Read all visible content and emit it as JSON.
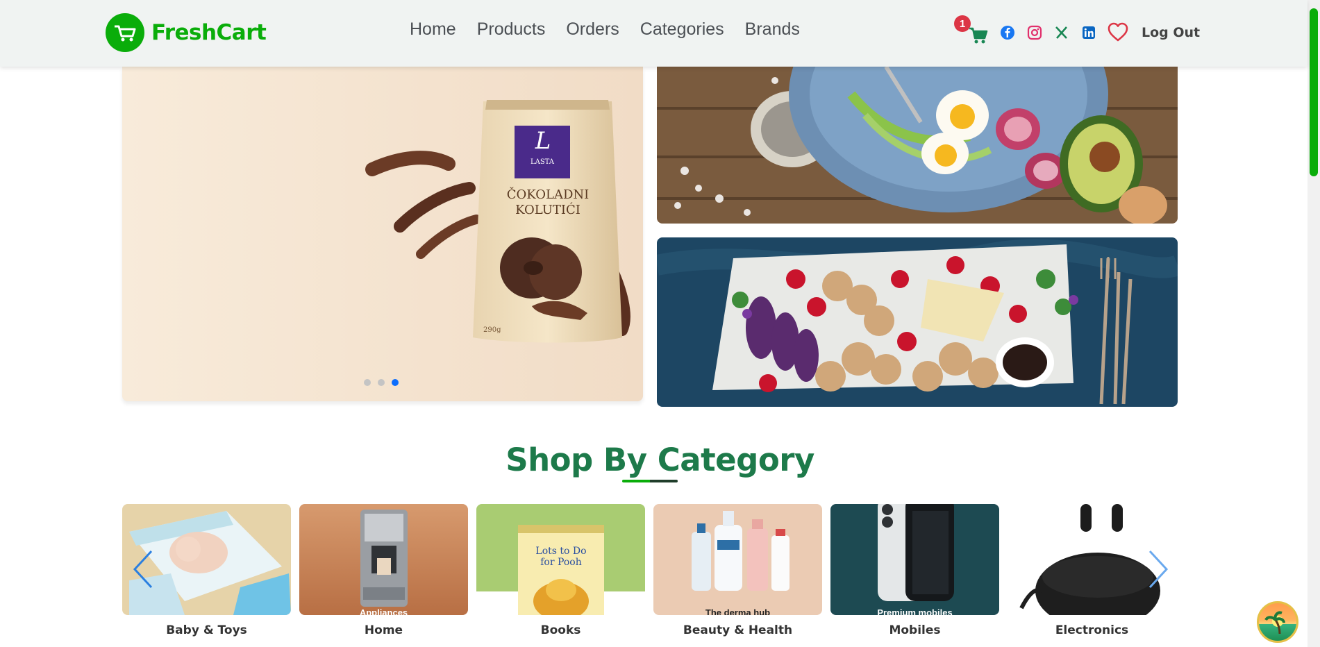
{
  "brand": {
    "name": "FreshCart"
  },
  "nav": {
    "links": [
      "Home",
      "Products",
      "Orders",
      "Categories",
      "Brands"
    ],
    "cart_count": "1",
    "logout_label": "Log Out"
  },
  "hero": {
    "product_brand": "LASTA",
    "product_name_line1": "ČOKOLADNI",
    "product_name_line2": "KOLUTIĆI",
    "product_weight": "290g",
    "slide_count": 3,
    "active_slide": 3
  },
  "section": {
    "title": "Shop By Category"
  },
  "categories": [
    {
      "label": "Baby & Toys",
      "caption": ""
    },
    {
      "label": "Home",
      "caption": "Appliances"
    },
    {
      "label": "Books",
      "caption": ""
    },
    {
      "label": "Beauty & Health",
      "caption": "The derma hub"
    },
    {
      "label": "Mobiles",
      "caption": "Premium mobiles"
    },
    {
      "label": "Electronics",
      "caption": ""
    }
  ],
  "colors": {
    "brand_green": "#0aad0a",
    "title_green": "#1d7a4a",
    "badge_red": "#dc3545"
  }
}
